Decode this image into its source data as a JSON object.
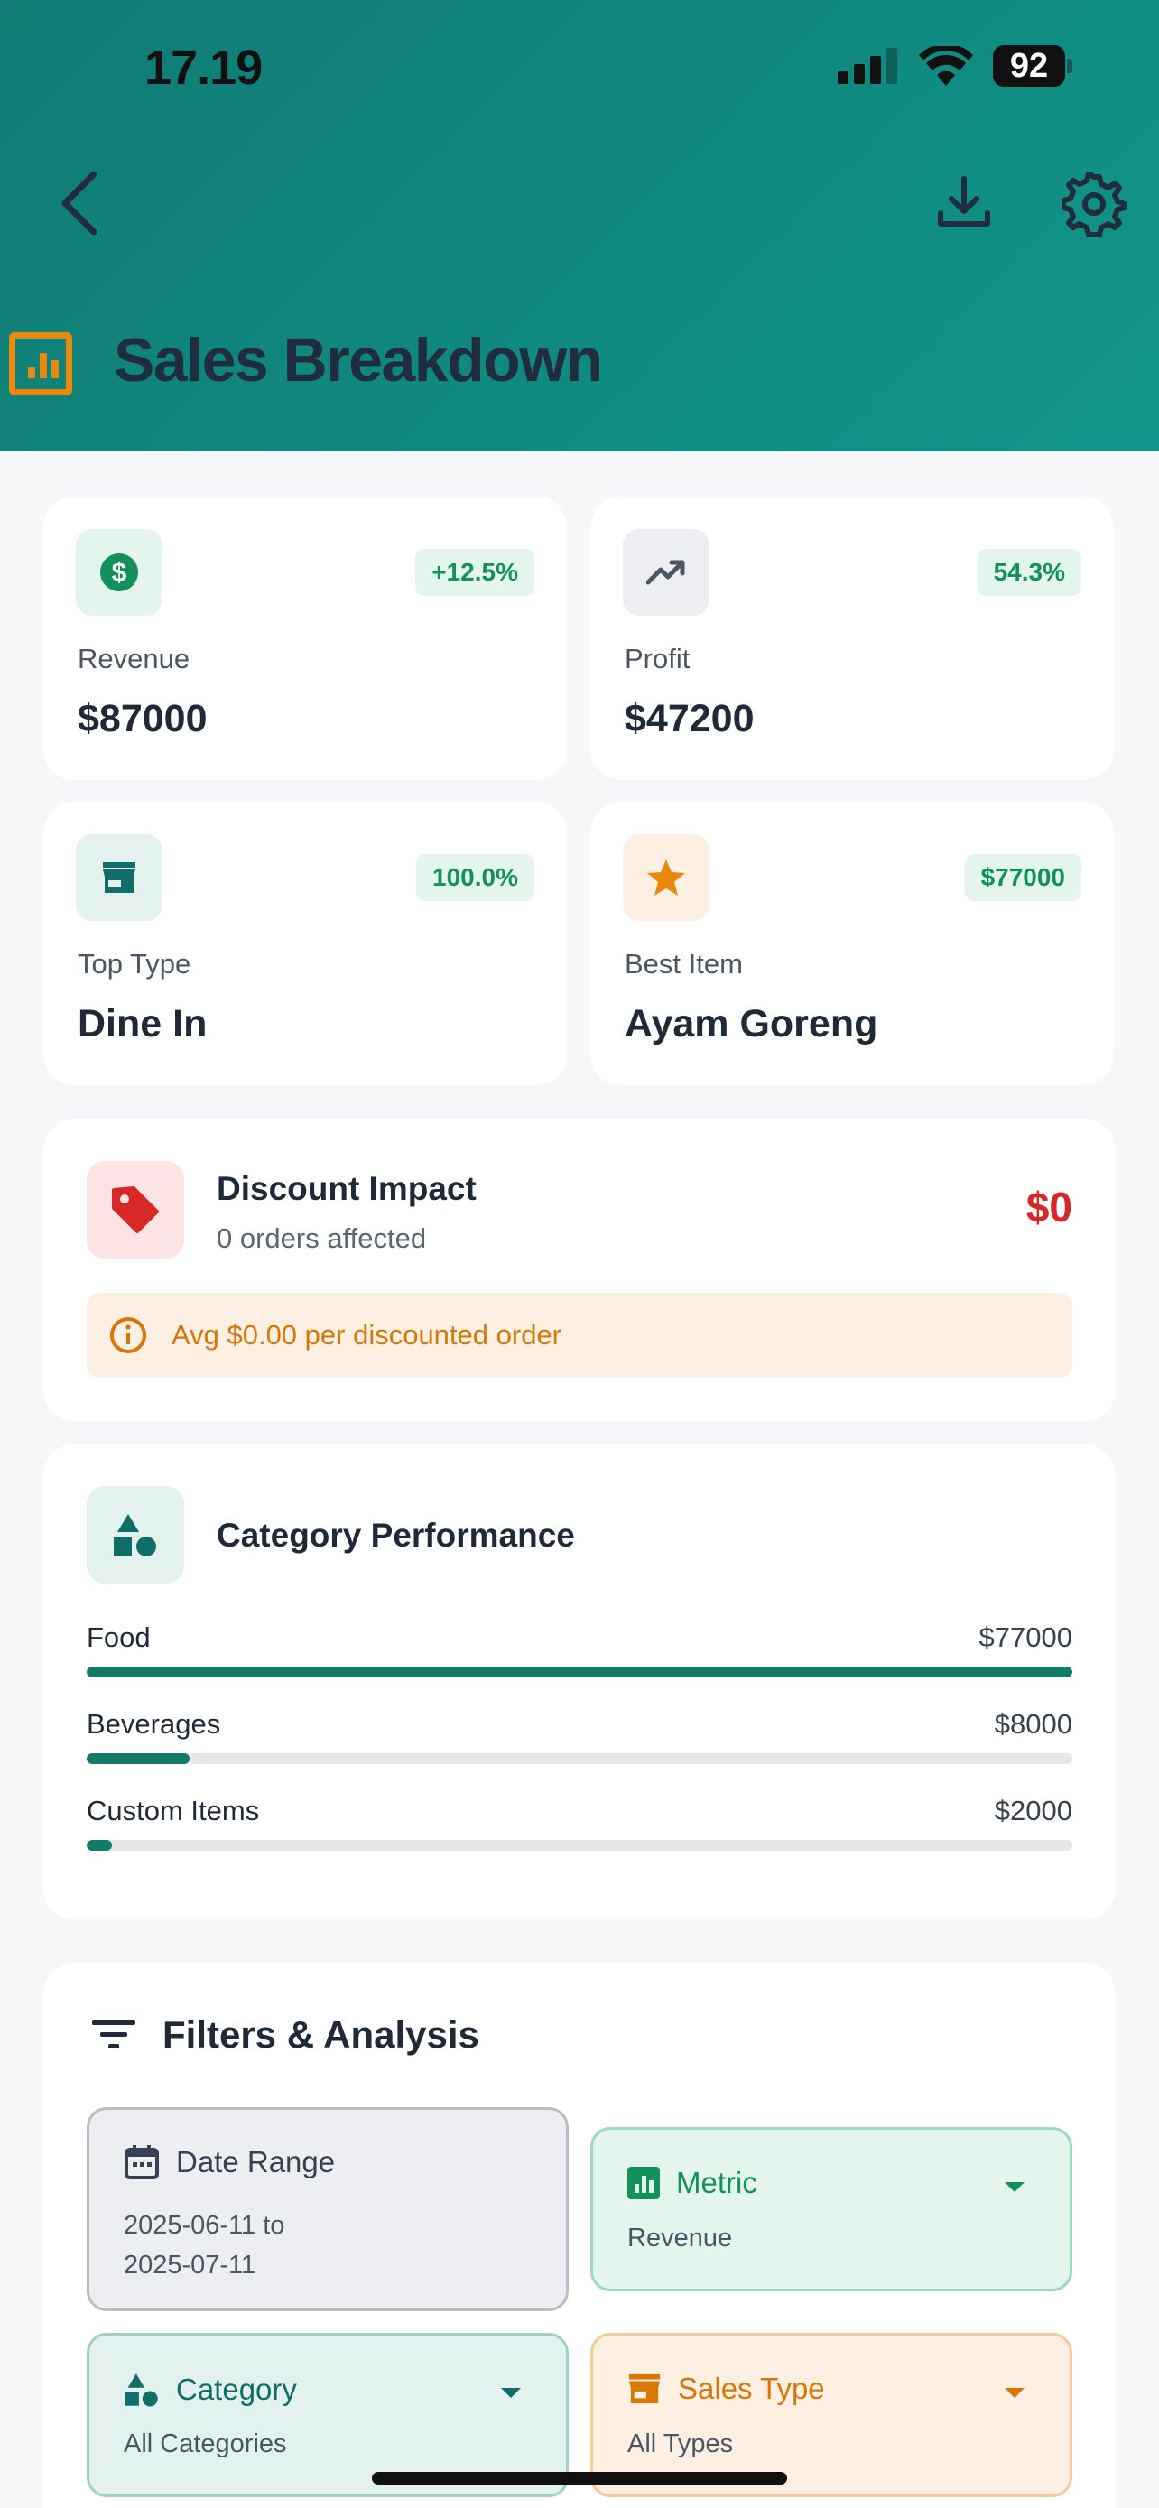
{
  "status_bar": {
    "time": "17.19",
    "battery": "92"
  },
  "header": {
    "title": "Sales Breakdown"
  },
  "stats": [
    {
      "label": "Revenue",
      "value": "$87000",
      "badge": "+12.5%",
      "icon": "dollar-icon"
    },
    {
      "label": "Profit",
      "value": "$47200",
      "badge": "54.3%",
      "icon": "trending-up-icon"
    },
    {
      "label": "Top Type",
      "value": "Dine In",
      "badge": "100.0%",
      "icon": "store-icon"
    },
    {
      "label": "Best Item",
      "value": "Ayam Goreng",
      "badge": "$77000",
      "icon": "star-icon"
    }
  ],
  "discount": {
    "title": "Discount Impact",
    "subtitle": "0 orders affected",
    "amount": "$0",
    "note": "Avg $0.00 per discounted order"
  },
  "category_performance": {
    "title": "Category Performance",
    "items": [
      {
        "name": "Food",
        "amount": "$77000",
        "share": 1.0
      },
      {
        "name": "Beverages",
        "amount": "$8000",
        "share": 0.104
      },
      {
        "name": "Custom Items",
        "amount": "$2000",
        "share": 0.026
      }
    ]
  },
  "filters": {
    "title": "Filters & Analysis",
    "date_range": {
      "label": "Date Range",
      "value_line1": "2025-06-11 to",
      "value_line2": "2025-07-11"
    },
    "metric": {
      "label": "Metric",
      "value": "Revenue"
    },
    "category": {
      "label": "Category",
      "value": "All Categories"
    },
    "sales_type": {
      "label": "Sales Type",
      "value": "All Types"
    }
  },
  "colors": {
    "header_teal": "#0f7b74",
    "accent_orange": "#e8890c",
    "positive_green": "#12925a",
    "danger_red": "#d62828"
  }
}
